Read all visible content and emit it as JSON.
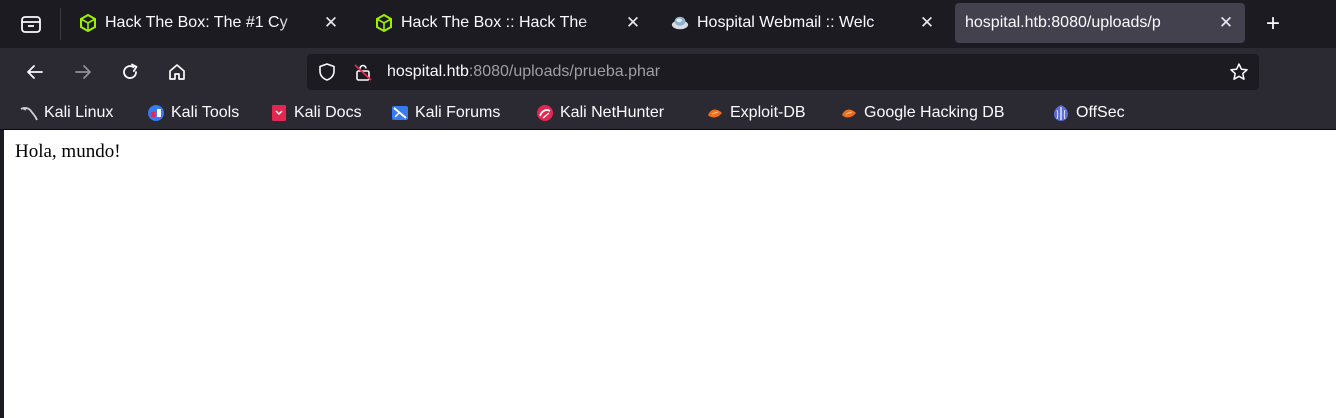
{
  "tabs": [
    {
      "title": "Hack The Box: The #1 Cy",
      "favicon": "htb-cube-icon",
      "active": false
    },
    {
      "title": "Hack The Box :: Hack The",
      "favicon": "htb-cube-icon",
      "active": false
    },
    {
      "title": "Hospital Webmail :: Welc",
      "favicon": "roundcube-icon",
      "active": false
    },
    {
      "title": "hospital.htb:8080/uploads/p",
      "favicon": "",
      "active": true
    }
  ],
  "tab_close_glyph": "✕",
  "new_tab_glyph": "+",
  "urlbar": {
    "host": "hospital.htb",
    "rest": ":8080/uploads/prueba.phar"
  },
  "bookmarks": [
    {
      "label": "Kali Linux",
      "icon": "kali-dragon-icon"
    },
    {
      "label": "Kali Tools",
      "icon": "kali-tools-icon"
    },
    {
      "label": "Kali Docs",
      "icon": "kali-docs-icon"
    },
    {
      "label": "Kali Forums",
      "icon": "kali-forums-icon"
    },
    {
      "label": "Kali NetHunter",
      "icon": "kali-nethunter-icon"
    },
    {
      "label": "Exploit-DB",
      "icon": "exploit-db-icon"
    },
    {
      "label": "Google Hacking DB",
      "icon": "ghdb-icon"
    },
    {
      "label": "OffSec",
      "icon": "offsec-icon"
    }
  ],
  "page": {
    "body_text": "Hola, mundo!"
  },
  "colors": {
    "htb_green": "#9fef00",
    "chrome_dark": "#1c1b22",
    "toolbar": "#2b2a33",
    "active_tab": "#42414d"
  }
}
